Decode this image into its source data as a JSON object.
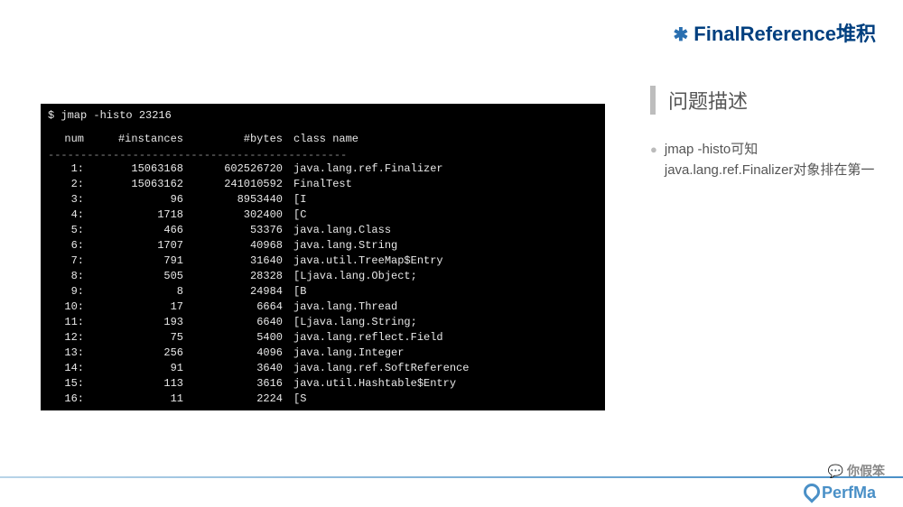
{
  "header": {
    "title": "FinalReference堆积"
  },
  "terminal": {
    "command": "$ jmap -histo 23216",
    "columns": {
      "c1": "num",
      "c2": "#instances",
      "c3": "#bytes",
      "c4": "class name"
    },
    "separator": "----------------------------------------------",
    "rows": [
      {
        "n": "1:",
        "inst": "15063168",
        "bytes": "602526720",
        "cls": "java.lang.ref.Finalizer"
      },
      {
        "n": "2:",
        "inst": "15063162",
        "bytes": "241010592",
        "cls": "FinalTest"
      },
      {
        "n": "3:",
        "inst": "96",
        "bytes": "8953440",
        "cls": "[I"
      },
      {
        "n": "4:",
        "inst": "1718",
        "bytes": "302400",
        "cls": "[C"
      },
      {
        "n": "5:",
        "inst": "466",
        "bytes": "53376",
        "cls": "java.lang.Class"
      },
      {
        "n": "6:",
        "inst": "1707",
        "bytes": "40968",
        "cls": "java.lang.String"
      },
      {
        "n": "7:",
        "inst": "791",
        "bytes": "31640",
        "cls": "java.util.TreeMap$Entry"
      },
      {
        "n": "8:",
        "inst": "505",
        "bytes": "28328",
        "cls": "[Ljava.lang.Object;"
      },
      {
        "n": "9:",
        "inst": "8",
        "bytes": "24984",
        "cls": "[B"
      },
      {
        "n": "10:",
        "inst": "17",
        "bytes": "6664",
        "cls": "java.lang.Thread"
      },
      {
        "n": "11:",
        "inst": "193",
        "bytes": "6640",
        "cls": "[Ljava.lang.String;"
      },
      {
        "n": "12:",
        "inst": "75",
        "bytes": "5400",
        "cls": "java.lang.reflect.Field"
      },
      {
        "n": "13:",
        "inst": "256",
        "bytes": "4096",
        "cls": "java.lang.Integer"
      },
      {
        "n": "14:",
        "inst": "91",
        "bytes": "3640",
        "cls": "java.lang.ref.SoftReference"
      },
      {
        "n": "15:",
        "inst": "113",
        "bytes": "3616",
        "cls": "java.util.Hashtable$Entry"
      },
      {
        "n": "16:",
        "inst": "11",
        "bytes": "2224",
        "cls": "[S"
      }
    ]
  },
  "sidebar": {
    "title": "问题描述",
    "bullet": "jmap -histo可知java.lang.ref.Finalizer对象排在第一"
  },
  "watermark": {
    "text": "你假笨"
  },
  "logo": {
    "text": "PerfMa"
  }
}
